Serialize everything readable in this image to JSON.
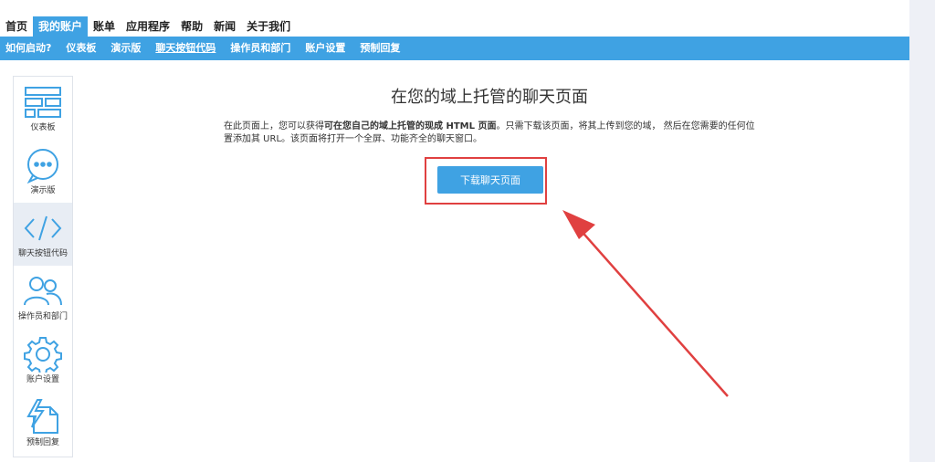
{
  "topnav": {
    "items": [
      "首页",
      "我的账户",
      "账单",
      "应用程序",
      "帮助",
      "新闻",
      "关于我们"
    ],
    "active_index": 1
  },
  "subnav": {
    "items": [
      "如何启动?",
      "仪表板",
      "演示版",
      "聊天按钮代码",
      "操作员和部门",
      "账户设置",
      "预制回复"
    ],
    "current_index": 3
  },
  "sidebar": {
    "items": [
      {
        "label": "仪表板",
        "icon": "dashboard-icon"
      },
      {
        "label": "演示版",
        "icon": "chat-bubble-icon"
      },
      {
        "label": "聊天按钮代码",
        "icon": "code-icon"
      },
      {
        "label": "操作员和部门",
        "icon": "users-icon"
      },
      {
        "label": "账户设置",
        "icon": "gear-icon"
      },
      {
        "label": "预制回复",
        "icon": "quick-reply-icon"
      }
    ],
    "selected_index": 2
  },
  "main": {
    "title": "在您的域上托管的聊天页面",
    "desc_part1": "在此页面上，您可以获得",
    "desc_bold": "可在您自己的域上托管的现成 HTML 页面",
    "desc_part2": "。只需下载该页面，将其上传到您的域， 然后在您需要的任何位置添加其 URL。该页面将打开一个全屏、功能齐全的聊天窗口。",
    "button_label": "下载聊天页面"
  },
  "colors": {
    "accent": "#3fa2e3",
    "annotation_red": "#e04040",
    "sidebar_selected_bg": "#e8edf4",
    "gutter": "#eef0f6"
  }
}
